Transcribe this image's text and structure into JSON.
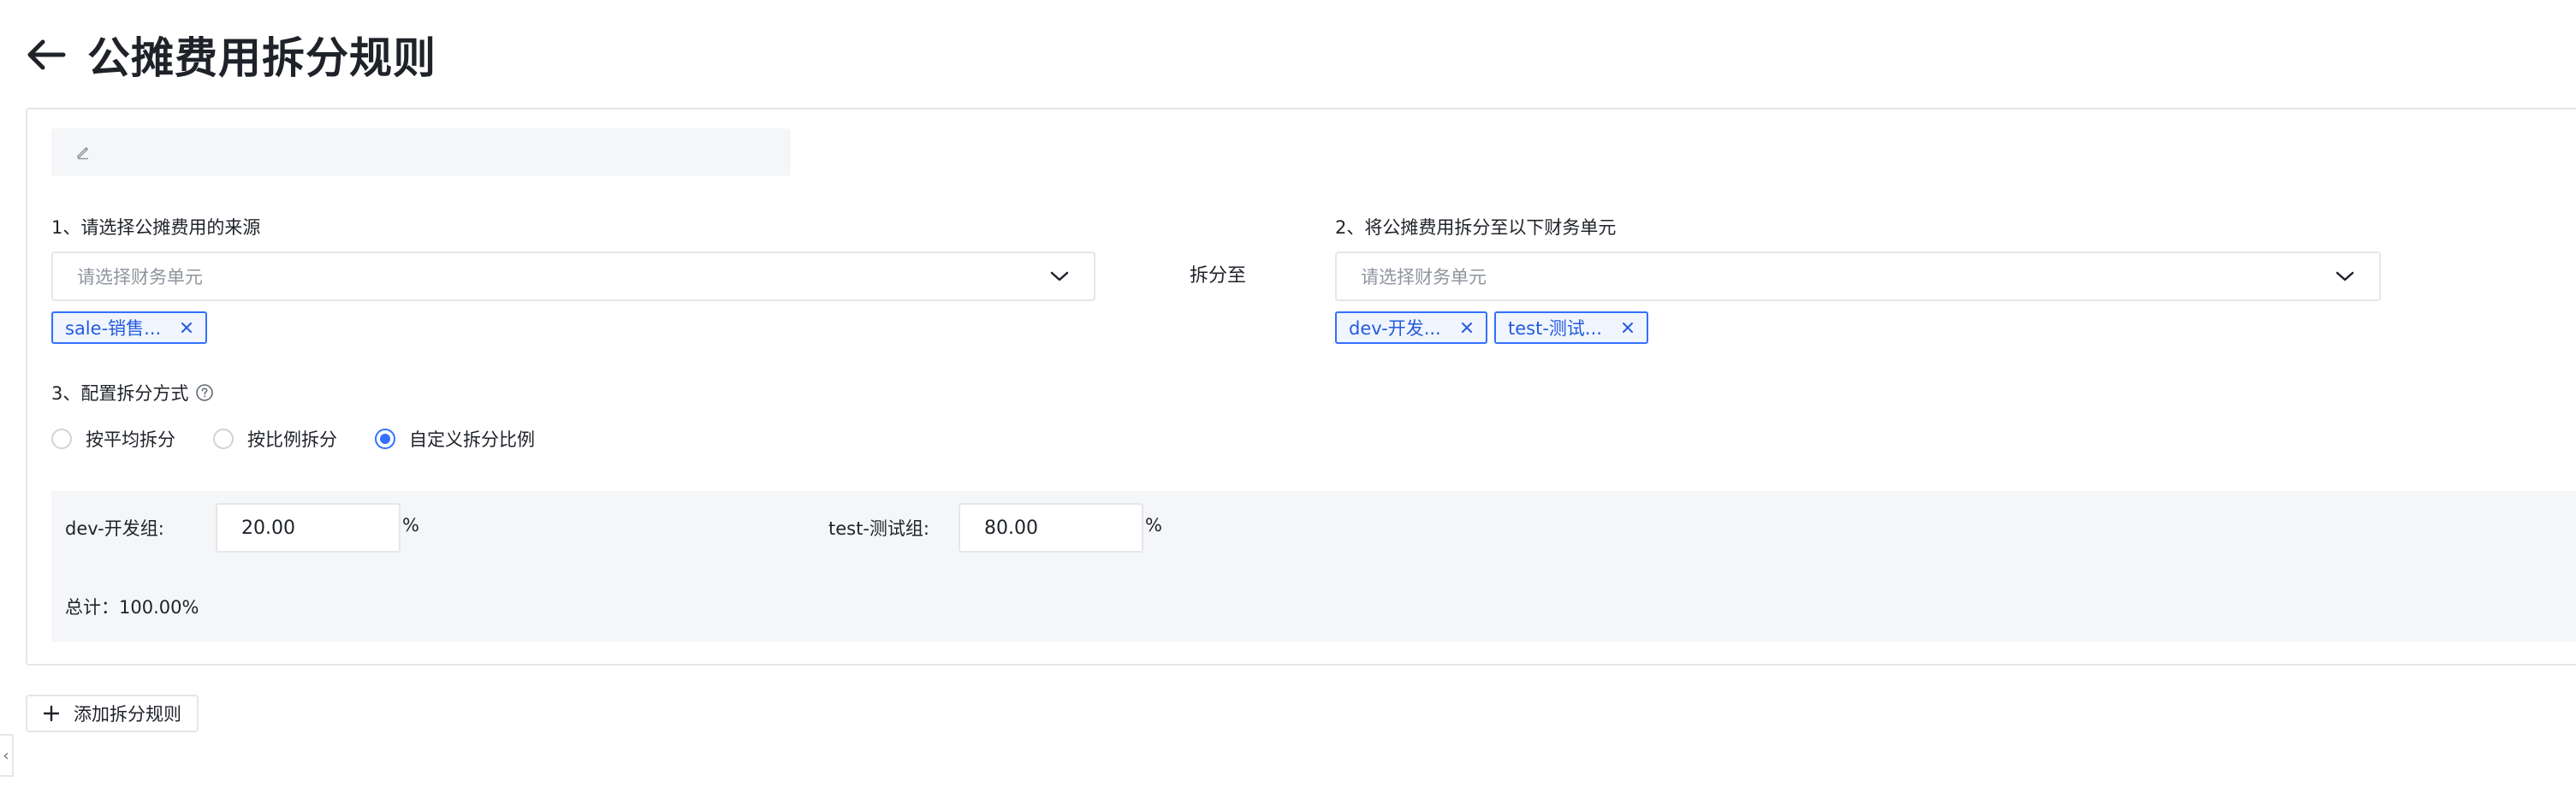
{
  "page": {
    "title": "公摊费用拆分规则"
  },
  "rule": {
    "source_label": "1、请选择公摊费用的来源",
    "source_placeholder": "请选择财务单元",
    "source_tags": [
      "sale-销售..."
    ],
    "split_to_label": "拆分至",
    "target_label": "2、将公摊费用拆分至以下财务单元",
    "target_placeholder": "请选择财务单元",
    "target_tags": [
      "dev-开发...",
      "test-测试..."
    ],
    "method_label": "3、配置拆分方式",
    "methods": [
      {
        "label": "按平均拆分",
        "checked": false
      },
      {
        "label": "按比例拆分",
        "checked": false
      },
      {
        "label": "自定义拆分比例",
        "checked": true
      }
    ],
    "ratios": [
      {
        "label": "dev-开发组:",
        "value": "20.00",
        "unit": "%"
      },
      {
        "label": "test-测试组:",
        "value": "80.00",
        "unit": "%"
      }
    ],
    "total": "总计：100.00%"
  },
  "actions": {
    "add_rule_label": "添加拆分规则",
    "collapse_glyph": "‹"
  },
  "icons": {
    "back": "arrow-left-icon",
    "edit": "pencil-icon",
    "dropdown": "chevron-down-icon",
    "remove": "close-icon",
    "help": "question-circle-icon",
    "add": "plus-icon"
  },
  "colors": {
    "accent": "#3370ff",
    "tag_bg": "#f0f5ff",
    "panel_bg": "#f5f6f7",
    "border": "#e5e6eb"
  }
}
